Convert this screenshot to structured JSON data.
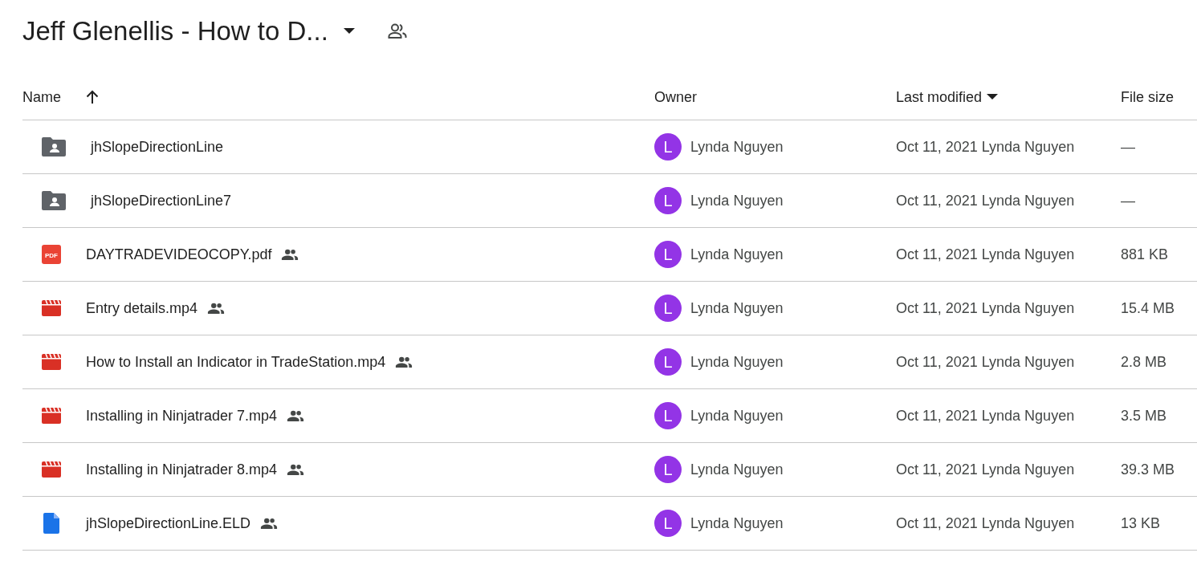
{
  "folder_title": "Jeff Glenellis - How to D...",
  "table": {
    "columns": [
      {
        "label": "Name",
        "sorted": true,
        "descending": false
      },
      {
        "label": "Owner"
      },
      {
        "label": "Last modified",
        "menu": true
      },
      {
        "label": "File size"
      }
    ],
    "rows": [
      {
        "kind": "folder",
        "name": "jhSlopeDirectionLine",
        "shared": false,
        "owner_initial": "L",
        "owner": "Lynda Nguyen",
        "modified": "Oct 11, 2021 Lynda Nguyen",
        "size": "—"
      },
      {
        "kind": "folder",
        "name": "jhSlopeDirectionLine7",
        "shared": false,
        "owner_initial": "L",
        "owner": "Lynda Nguyen",
        "modified": "Oct 11, 2021 Lynda Nguyen",
        "size": "—"
      },
      {
        "kind": "pdf",
        "icon_label": "PDF",
        "name": "DAYTRADEVIDEOCOPY.pdf",
        "shared": true,
        "owner_initial": "L",
        "owner": "Lynda Nguyen",
        "modified": "Oct 11, 2021 Lynda Nguyen",
        "size": "881 KB"
      },
      {
        "kind": "video",
        "name": "Entry details.mp4",
        "shared": true,
        "owner_initial": "L",
        "owner": "Lynda Nguyen",
        "modified": "Oct 11, 2021 Lynda Nguyen",
        "size": "15.4 MB"
      },
      {
        "kind": "video",
        "name": "How to Install an Indicator in TradeStation.mp4",
        "shared": true,
        "owner_initial": "L",
        "owner": "Lynda Nguyen",
        "modified": "Oct 11, 2021 Lynda Nguyen",
        "size": "2.8 MB"
      },
      {
        "kind": "video",
        "name": "Installing in Ninjatrader 7.mp4",
        "shared": true,
        "owner_initial": "L",
        "owner": "Lynda Nguyen",
        "modified": "Oct 11, 2021 Lynda Nguyen",
        "size": "3.5 MB"
      },
      {
        "kind": "video",
        "name": "Installing in Ninjatrader 8.mp4",
        "shared": true,
        "owner_initial": "L",
        "owner": "Lynda Nguyen",
        "modified": "Oct 11, 2021 Lynda Nguyen",
        "size": "39.3 MB"
      },
      {
        "kind": "document",
        "name": "jhSlopeDirectionLine.ELD",
        "shared": true,
        "owner_initial": "L",
        "owner": "Lynda Nguyen",
        "modified": "Oct 11, 2021 Lynda Nguyen",
        "size": "13 KB"
      }
    ]
  }
}
